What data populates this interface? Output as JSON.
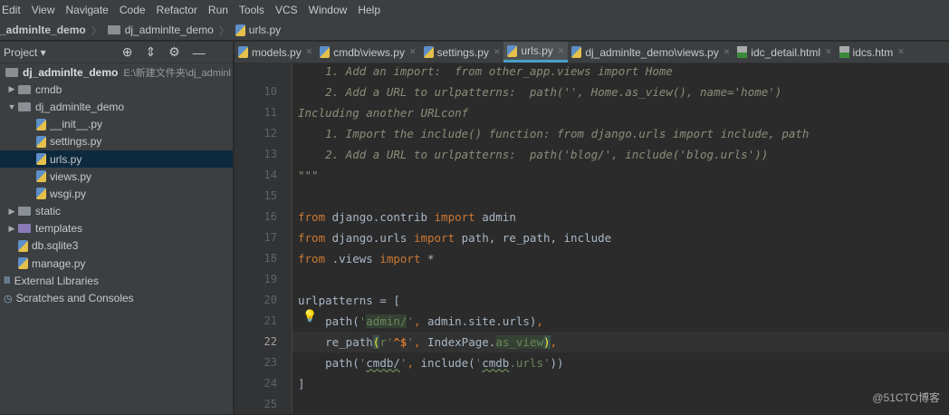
{
  "menu": [
    "Edit",
    "View",
    "Navigate",
    "Code",
    "Refactor",
    "Run",
    "Tools",
    "VCS",
    "Window",
    "Help"
  ],
  "breadcrumb": {
    "project": "_adminlte_demo",
    "folder": "dj_adminlte_demo",
    "file": "urls.py"
  },
  "sidebar": {
    "title": "Project ▾",
    "icons": [
      "locate-icon",
      "collapse-icon",
      "gear-icon",
      "minimize-icon"
    ],
    "root": {
      "label": "dj_adminlte_demo",
      "path": "E:\\新建文件夹\\dj_adminl"
    },
    "items": [
      {
        "label": "cmdb",
        "type": "folder",
        "depth": 1,
        "arrow": "▶"
      },
      {
        "label": "dj_adminlte_demo",
        "type": "folder",
        "depth": 1,
        "arrow": "▼"
      },
      {
        "label": "__init__.py",
        "type": "py",
        "depth": 2
      },
      {
        "label": "settings.py",
        "type": "py",
        "depth": 2
      },
      {
        "label": "urls.py",
        "type": "py",
        "depth": 2,
        "selected": true
      },
      {
        "label": "views.py",
        "type": "py",
        "depth": 2
      },
      {
        "label": "wsgi.py",
        "type": "py",
        "depth": 2
      },
      {
        "label": "static",
        "type": "folder",
        "depth": 1,
        "arrow": "▶"
      },
      {
        "label": "templates",
        "type": "folder-purple",
        "depth": 1,
        "arrow": "▶"
      },
      {
        "label": "db.sqlite3",
        "type": "py",
        "depth": 1
      },
      {
        "label": "manage.py",
        "type": "py",
        "depth": 1
      },
      {
        "label": "External Libraries",
        "type": "lib",
        "depth": 0
      },
      {
        "label": "Scratches and Consoles",
        "type": "scratch",
        "depth": 0
      }
    ]
  },
  "tabs": [
    {
      "label": "models.py",
      "type": "py"
    },
    {
      "label": "cmdb\\views.py",
      "type": "py"
    },
    {
      "label": "settings.py",
      "type": "py"
    },
    {
      "label": "urls.py",
      "type": "py",
      "active": true
    },
    {
      "label": "dj_adminlte_demo\\views.py",
      "type": "py"
    },
    {
      "label": "idc_detail.html",
      "type": "html"
    },
    {
      "label": "idcs.htm",
      "type": "html"
    }
  ],
  "editor": {
    "current_line": 22,
    "lines": [
      {
        "n": "",
        "tokens": [
          [
            "    1. Add an import:  from other_app.views import Home",
            "doc"
          ]
        ]
      },
      {
        "n": "10",
        "tokens": [
          [
            "    2. Add a URL to urlpatterns:  path('', Home.as_view(), name='home')",
            "doc"
          ]
        ]
      },
      {
        "n": "11",
        "tokens": [
          [
            "Including another URLconf",
            "doc"
          ]
        ]
      },
      {
        "n": "12",
        "tokens": [
          [
            "    1. Import the include() function: from django.urls import include, path",
            "doc"
          ]
        ]
      },
      {
        "n": "13",
        "tokens": [
          [
            "    2. Add a URL to urlpatterns:  path('blog/', include('blog.urls'))",
            "doc"
          ]
        ]
      },
      {
        "n": "14",
        "tokens": [
          [
            "\"\"\"",
            "doc"
          ]
        ]
      },
      {
        "n": "15",
        "tokens": []
      },
      {
        "n": "16",
        "tokens": [
          [
            "from",
            "kw"
          ],
          [
            " django.contrib ",
            "fn"
          ],
          [
            "import",
            "kw"
          ],
          [
            " admin",
            "fn"
          ]
        ]
      },
      {
        "n": "17",
        "tokens": [
          [
            "from",
            "kw"
          ],
          [
            " django.urls ",
            "fn"
          ],
          [
            "import",
            "kw"
          ],
          [
            " path, re_path, include",
            "fn"
          ]
        ]
      },
      {
        "n": "18",
        "tokens": [
          [
            "from",
            "kw"
          ],
          [
            " .views ",
            "fn"
          ],
          [
            "import",
            "kw"
          ],
          [
            " *",
            "fn"
          ]
        ]
      },
      {
        "n": "19",
        "tokens": []
      },
      {
        "n": "20",
        "tokens": [
          [
            "urlpatterns = [",
            "fn"
          ]
        ]
      },
      {
        "n": "21",
        "tokens": [
          [
            "    path(",
            "fn"
          ],
          [
            "'",
            "str"
          ],
          [
            "admin/",
            "strhl"
          ],
          [
            "'",
            "str"
          ],
          [
            "kw_comma",
            "none"
          ],
          [
            " admin.site.urls)",
            "fn"
          ],
          [
            ",",
            "kw"
          ]
        ]
      },
      {
        "n": "22",
        "tokens": [
          [
            "    re_path",
            "fn"
          ],
          [
            "(",
            "brace"
          ],
          [
            "r'",
            "str"
          ],
          [
            "^$",
            "bold"
          ],
          [
            "'",
            "str"
          ],
          [
            ",",
            "kw"
          ],
          [
            " IndexPage.",
            "fn"
          ],
          [
            "as_view",
            "strhl"
          ],
          [
            ")",
            "brace"
          ],
          [
            ",",
            "kw"
          ]
        ]
      },
      {
        "n": "23",
        "tokens": [
          [
            "    path(",
            "fn"
          ],
          [
            "'",
            "str"
          ],
          [
            "cmdb/",
            "und"
          ],
          [
            "'",
            "str"
          ],
          [
            ",",
            "kw"
          ],
          [
            " include(",
            "fn"
          ],
          [
            "'",
            "str"
          ],
          [
            "cmdb",
            "und"
          ],
          [
            ".urls'",
            "str"
          ],
          [
            "))",
            "fn"
          ]
        ]
      },
      {
        "n": "24",
        "tokens": [
          [
            "]",
            "fn"
          ]
        ]
      },
      {
        "n": "25",
        "tokens": []
      }
    ]
  },
  "watermark": "@51CTO博客"
}
